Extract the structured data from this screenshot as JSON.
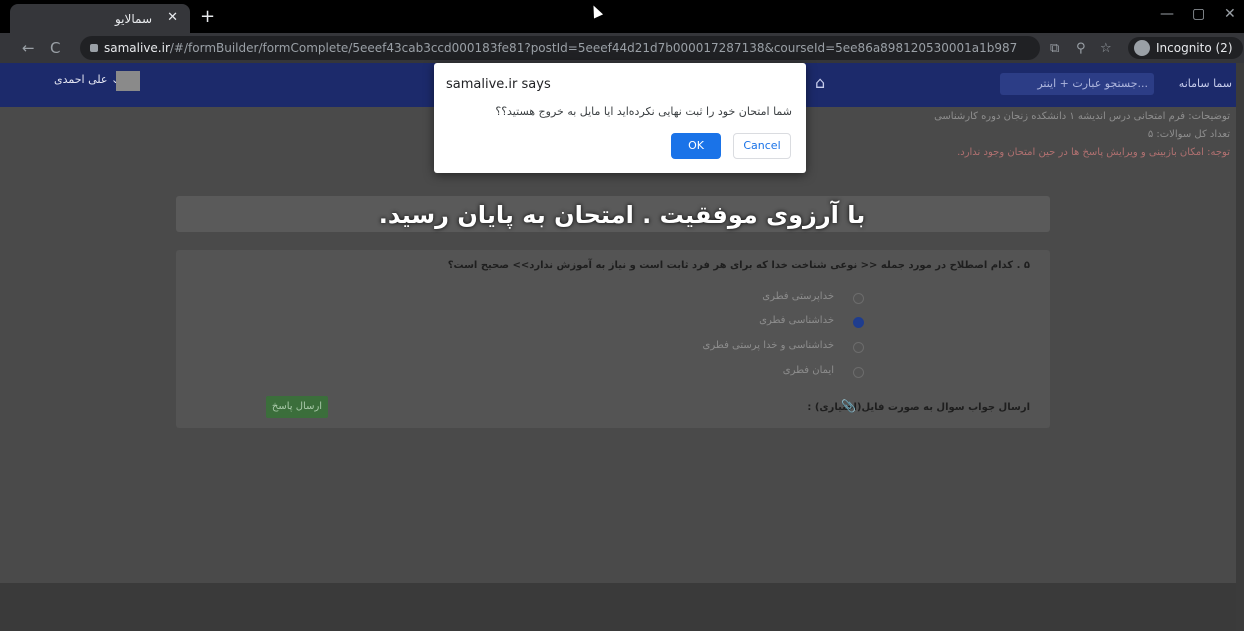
{
  "browser": {
    "tab_title": "سمالایو",
    "tab_close": "✕",
    "new_tab": "+",
    "url_host": "samalive.ir",
    "url_path": "/#/formBuilder/formComplete/5eeef43cab3ccd000183fe81?postId=5eeef44d21d7b000017287138&courseId=5ee86a898120530001a1b987",
    "incognito_label": "Incognito (2)",
    "back": "←",
    "reload": "C",
    "minimize": "—",
    "restore": "▢",
    "close": "✕",
    "translate_icon": "⧉",
    "zoom_icon": "⚲",
    "star_icon": "☆"
  },
  "app": {
    "brand": "سما سامانه",
    "search_placeholder": "جستجو عبارت + اینتر...",
    "user_name": "علی احمدی ⌄",
    "home_icon": "⌂",
    "info_desc": "توضیحات: فرم امتحانی درس اندیشه ۱ دانشکده زنجان دوره کارشناسی",
    "info_count": "تعداد کل سوالات: ۵",
    "info_warning": "توجه: امکان بازبینی و ویرایش پاسخ ها در حین امتحان وجود ندارد."
  },
  "overlay_text": "با آرزوی موفقیت . امتحان به پایان رسید.",
  "question": {
    "text": "۵ . کدام اصطلاح در مورد جمله << نوعی شناخت خدا که برای هر فرد ثابت است و نیاز به آموزش ندارد>> صحیح است؟",
    "options": [
      {
        "label": "خداپرستی فطری",
        "selected": false
      },
      {
        "label": "خداشناسی فطری",
        "selected": true
      },
      {
        "label": "خداشناسی و خدا پرستی فطری",
        "selected": false
      },
      {
        "label": "ایمان فطری",
        "selected": false
      }
    ],
    "attach_label": "ارسال جواب سوال به صورت فایل(اختیاری) :",
    "send_button": "ارسال پاسخ"
  },
  "dialog": {
    "title": "samalive.ir says",
    "message": "شما امتحان خود را ثبت نهایی نکرده‌اید ایا مایل به خروج هستید؟؟",
    "ok": "OK",
    "cancel": "Cancel"
  },
  "colors": {
    "app_bar": "#1c2a6b",
    "ok_button": "#1a73e8",
    "selected_radio": "#1f3d8e",
    "send_button": "#3b6e3b"
  }
}
